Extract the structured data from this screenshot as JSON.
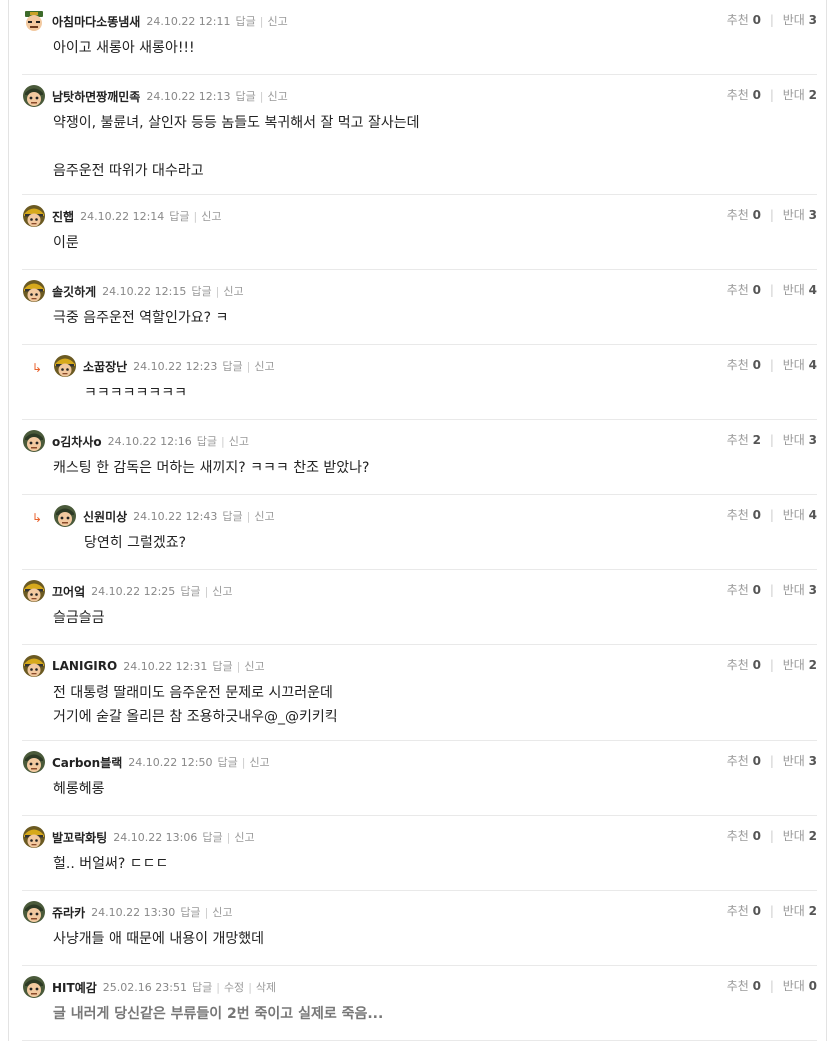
{
  "labels": {
    "reply": "답글",
    "report": "신고",
    "edit": "수정",
    "delete": "삭제",
    "like": "추천",
    "dislike": "반대"
  },
  "comments": [
    {
      "nick": "아침마다소똥냄새",
      "date": "24.10.22 12:11",
      "text": "아이고 새롱아 새롱아!!!",
      "like": "0",
      "dislike": "3",
      "avatar": "green"
    },
    {
      "nick": "남탓하면짱깨민족",
      "date": "24.10.22 12:13",
      "text": "약쟁이, 불륜녀, 살인자 등등 놈들도 복귀해서 잘 먹고 잘사는데\n\n음주운전 따위가 대수라고",
      "like": "0",
      "dislike": "2",
      "avatar": "dark"
    },
    {
      "nick": "진햅",
      "date": "24.10.22 12:14",
      "text": "이룬",
      "like": "0",
      "dislike": "3",
      "avatar": "yellow"
    },
    {
      "nick": "솔깃하게",
      "date": "24.10.22 12:15",
      "text": "극중 음주운전 역할인가요? ㅋ",
      "like": "0",
      "dislike": "4",
      "avatar": "yellow"
    },
    {
      "nick": "소꿉장난",
      "date": "24.10.22 12:23",
      "text": "ㅋㅋㅋㅋㅋㅋㅋㅋ",
      "like": "0",
      "dislike": "4",
      "avatar": "yellow",
      "reply": true
    },
    {
      "nick": "o김차사o",
      "date": "24.10.22 12:16",
      "text": "캐스팅 한 감독은 머하는 새끼지? ㅋㅋㅋ 찬조 받았나?",
      "like": "2",
      "dislike": "3",
      "avatar": "dark"
    },
    {
      "nick": "신원미상",
      "date": "24.10.22 12:43",
      "text": "당연히 그럴겠죠?",
      "like": "0",
      "dislike": "4",
      "avatar": "dark",
      "reply": true
    },
    {
      "nick": "끄어엌",
      "date": "24.10.22 12:25",
      "text": "슬금슬금",
      "like": "0",
      "dislike": "3",
      "avatar": "yellow"
    },
    {
      "nick": "LANIGIRO",
      "date": "24.10.22 12:31",
      "text": "전 대통령 딸래미도 음주운전 문제로 시끄러운데\n거기에 숟갈 올리믄 참 조용하긋내우@_@키키킥",
      "like": "0",
      "dislike": "2",
      "avatar": "yellow"
    },
    {
      "nick": "Carbon블랙",
      "date": "24.10.22 12:50",
      "text": "헤롱헤롱",
      "like": "0",
      "dislike": "3",
      "avatar": "dark"
    },
    {
      "nick": "발꼬락화팅",
      "date": "24.10.22 13:06",
      "text": "헐.. 버얼써? ㄷㄷㄷ",
      "like": "0",
      "dislike": "2",
      "avatar": "yellow"
    },
    {
      "nick": "쥬라카",
      "date": "24.10.22 13:30",
      "text": "사냥개들 애 때문에 내용이 개망했데",
      "like": "0",
      "dislike": "2",
      "avatar": "dark"
    },
    {
      "nick": "HIT예감",
      "date": "25.02.16 23:51",
      "text": "글 내러게 당신같은 부류들이 2번 죽이고 실제로 죽음...",
      "like": "0",
      "dislike": "0",
      "avatar": "dark",
      "own": true
    }
  ]
}
